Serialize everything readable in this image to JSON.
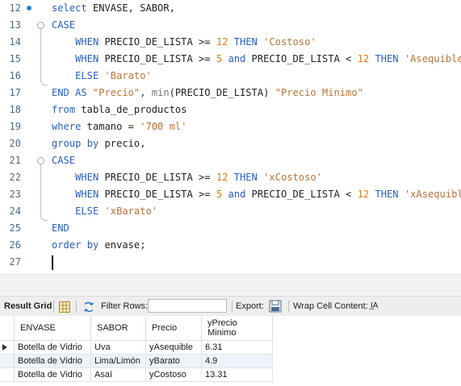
{
  "editor": {
    "lines": [
      {
        "n": "12",
        "html": "<span class=\"kw\">select</span> ENVASE, SABOR,"
      },
      {
        "n": "13",
        "html": "<span class=\"kw\">CASE</span>"
      },
      {
        "n": "14",
        "html": "    <span class=\"kw\">WHEN</span> PRECIO_DE_LISTA &gt;= <span class=\"num\">12</span> <span class=\"kw\">THEN</span> <span class=\"str\">'Costoso'</span>"
      },
      {
        "n": "15",
        "html": "    <span class=\"kw\">WHEN</span> PRECIO_DE_LISTA &gt;= <span class=\"num\">5</span> <span class=\"kw\">and</span> PRECIO_DE_LISTA &lt; <span class=\"num\">12</span> <span class=\"kw\">THEN</span> <span class=\"str\">'Asequible'</span>"
      },
      {
        "n": "16",
        "html": "    <span class=\"kw\">ELSE</span> <span class=\"str\">'Barato'</span>"
      },
      {
        "n": "17",
        "html": "<span class=\"kw\">END</span> <span class=\"kw\">AS</span> <span class=\"str\">\"Precio\"</span>, <span class=\"fn\">min</span>(PRECIO_DE_LISTA) <span class=\"str\">\"Precio Minimo\"</span>"
      },
      {
        "n": "18",
        "html": "<span class=\"kw\">from</span> tabla_de_productos"
      },
      {
        "n": "19",
        "html": "<span class=\"kw\">where</span> tamano = <span class=\"str\">'700 ml'</span>"
      },
      {
        "n": "20",
        "html": "<span class=\"kw\">group</span> <span class=\"kw\">by</span> precio,"
      },
      {
        "n": "21",
        "html": "<span class=\"kw\">CASE</span>"
      },
      {
        "n": "22",
        "html": "    <span class=\"kw\">WHEN</span> PRECIO_DE_LISTA &gt;= <span class=\"num\">12</span> <span class=\"kw\">THEN</span> <span class=\"str\">'xCostoso'</span>"
      },
      {
        "n": "23",
        "html": "    <span class=\"kw\">WHEN</span> PRECIO_DE_LISTA &gt;= <span class=\"num\">5</span> <span class=\"kw\">and</span> PRECIO_DE_LISTA &lt; <span class=\"num\">12</span> <span class=\"kw\">THEN</span> <span class=\"str\">'xAsequible'</span>"
      },
      {
        "n": "24",
        "html": "    <span class=\"kw\">ELSE</span> <span class=\"str\">'xBarato'</span>"
      },
      {
        "n": "25",
        "html": "<span class=\"kw\">END</span>"
      },
      {
        "n": "26",
        "html": "<span class=\"kw\">order</span> <span class=\"kw\">by</span> envase;"
      },
      {
        "n": "27",
        "html": ""
      }
    ]
  },
  "toolbar": {
    "result_grid": "Result Grid",
    "filter_rows": "Filter Rows:",
    "filter_value": "",
    "export": "Export:",
    "wrap": "Wrap Cell Content:",
    "wrap_icon": "I̲A"
  },
  "grid": {
    "columns": [
      "ENVASE",
      "SABOR",
      "Precio",
      "yPrecio\nMinimo"
    ],
    "rows": [
      [
        "Botella de Vidrio",
        "Uva",
        "yAsequible",
        "6.31"
      ],
      [
        "Botella de Vidrio",
        "Lima/Limón",
        "yBarato",
        "4.9"
      ],
      [
        "Botella de Vidrio",
        "Asaí",
        "yCostoso",
        "13.31"
      ]
    ]
  },
  "colors": {
    "keyword": "#2a5fc1",
    "number": "#e07b12",
    "string": "#b8743a"
  }
}
